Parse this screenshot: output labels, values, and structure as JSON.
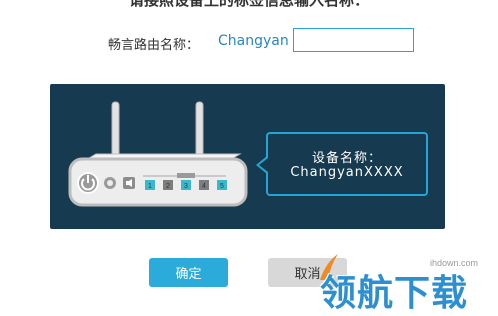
{
  "dialog": {
    "instruction": "请接照设备上的标签信息输入名称："
  },
  "name_row": {
    "label": "畅言路由名称：",
    "default_name": "Changyan",
    "input_value": ""
  },
  "illustration": {
    "bubble_line1": "设备名称：",
    "bubble_line2": "ChangyanXXXX",
    "port_labels": [
      "1",
      "2",
      "3",
      "4",
      "5"
    ],
    "colors": {
      "panel": "#163a4f",
      "accent": "#27a4d6",
      "router_body": "#ededed",
      "router_border": "#bdbdbd"
    }
  },
  "buttons": {
    "ok_label": "确定",
    "cancel_label": "取消"
  },
  "watermark": {
    "site": "ihdown.com",
    "text": "领航下载"
  }
}
